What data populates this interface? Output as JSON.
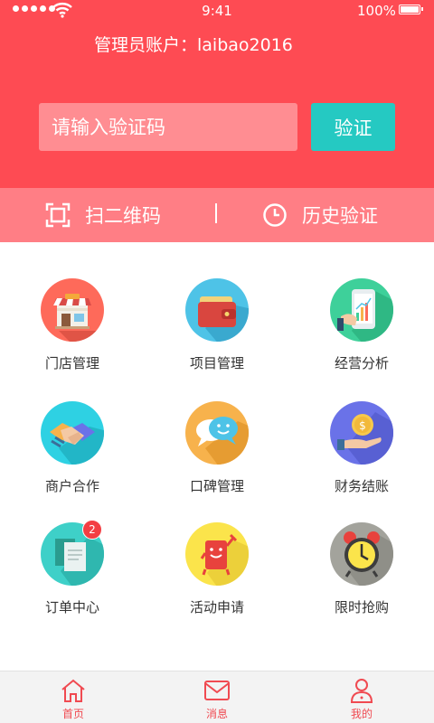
{
  "status_bar": {
    "time": "9:41",
    "battery": "100%"
  },
  "header": {
    "account_text": "管理员账户：laibao2016",
    "code_placeholder": "请输入验证码",
    "verify_label": "验证",
    "scan_label": "扫二维码",
    "history_label": "历史验证"
  },
  "grid": [
    {
      "label": "门店管理",
      "icon": "store-icon",
      "color": "#fe6a5a"
    },
    {
      "label": "项目管理",
      "icon": "wallet-icon",
      "color": "#4ec3e7"
    },
    {
      "label": "经营分析",
      "icon": "phone-chart-icon",
      "color": "#3ed09a"
    },
    {
      "label": "商户合作",
      "icon": "handshake-icon",
      "color": "#2ed1e3"
    },
    {
      "label": "口碑管理",
      "icon": "chat-bubbles-icon",
      "color": "#f7b24c"
    },
    {
      "label": "财务结账",
      "icon": "coin-hand-icon",
      "color": "#6a72e8"
    },
    {
      "label": "订单中心",
      "icon": "documents-icon",
      "color": "#3ed0c8",
      "badge": "2"
    },
    {
      "label": "活动申请",
      "icon": "red-envelope-icon",
      "color": "#fbe44b"
    },
    {
      "label": "限时抢购",
      "icon": "alarm-clock-icon",
      "color": "#a3a39c"
    }
  ],
  "tabbar": {
    "home": "首页",
    "messages": "消息",
    "mine": "我的"
  },
  "colors": {
    "header": "#fe4b53",
    "accent": "#25c9c2",
    "tab": "#f04a51"
  }
}
